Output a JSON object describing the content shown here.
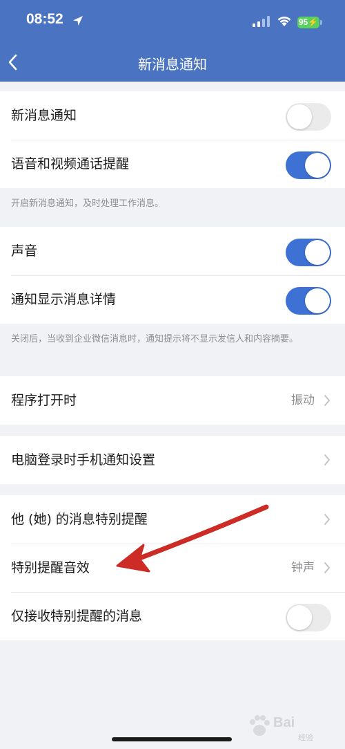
{
  "status_bar": {
    "time": "08:52",
    "battery": "95",
    "battery_color": "#5ad05f"
  },
  "nav": {
    "title": "新消息通知",
    "back_icon": "chevron-left-icon",
    "bar_color": "#4a74c2"
  },
  "group1": {
    "rows": [
      {
        "label": "新消息通知",
        "toggle": "off"
      },
      {
        "label": "语音和视频通话提醒",
        "toggle": "on"
      }
    ],
    "hint": "开启新消息通知，及时处理工作消息。"
  },
  "group2": {
    "rows": [
      {
        "label": "声音",
        "toggle": "on"
      },
      {
        "label": "通知显示消息详情",
        "toggle": "on"
      }
    ],
    "hint": "关闭后，当收到企业微信消息时，通知提示将不显示发信人和内容摘要。"
  },
  "group3": {
    "label": "程序打开时",
    "value": "振动"
  },
  "group4": {
    "label": "电脑登录时手机通知设置"
  },
  "group5": {
    "rows": [
      {
        "label": "他 (她) 的消息特别提醒"
      },
      {
        "label": "特别提醒音效",
        "value": "钟声"
      },
      {
        "label": "仅接收特别提醒的消息",
        "toggle": "off"
      }
    ]
  },
  "colors": {
    "toggle_on": "#3e71d4",
    "toggle_off": "#ebebeb",
    "arrow": "#cc2b26",
    "background": "#f1f2f6"
  },
  "watermark": {
    "text": "Bai",
    "sub": "经验"
  }
}
